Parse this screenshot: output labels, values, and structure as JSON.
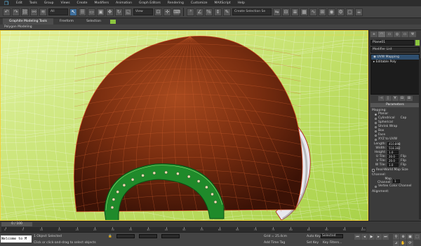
{
  "menu": [
    "Edit",
    "Tools",
    "Group",
    "Views",
    "Create",
    "Modifiers",
    "Animation",
    "Graph Editors",
    "Rendering",
    "Customize",
    "MAXScript",
    "Help"
  ],
  "toolbar": {
    "selection_filter": "All",
    "view_dropdown": "View",
    "named_selection": "Create Selection Se"
  },
  "ribbon": {
    "tabs": [
      "Graphite Modeling Tools",
      "Freeform",
      "Selection"
    ],
    "sub_label": "Polygon Modeling"
  },
  "viewport": {
    "colors": {
      "background": "#c8e66e",
      "sphere": "#7a2e10",
      "ring": "#1f8a2a",
      "border": "#f2d23b"
    }
  },
  "command_panel": {
    "tabs": [
      "+",
      "◠",
      "▭",
      "◎",
      "▭",
      "⚒"
    ],
    "object_name": "Plane01",
    "modifier_list": "Modifier List",
    "stack": [
      "UVW Mapping",
      "Editable Poly"
    ],
    "stack_buttons": [
      "⊣",
      "|",
      "∀",
      "⊟",
      "⊞"
    ],
    "rollout_title": "Parameters",
    "mapping_label": "Mapping:",
    "mapping_options": [
      {
        "label": "Planar",
        "selected": true
      },
      {
        "label": "Cylindrical",
        "selected": false,
        "extra": "Cap"
      },
      {
        "label": "Spherical",
        "selected": false
      },
      {
        "label": "Shrink Wrap",
        "selected": false
      },
      {
        "label": "Box",
        "selected": false
      },
      {
        "label": "Face",
        "selected": false
      },
      {
        "label": "XYZ to UVW",
        "selected": false
      }
    ],
    "length": {
      "label": "Length:",
      "value": "410.898"
    },
    "width": {
      "label": "Width:",
      "value": "518.382"
    },
    "height": {
      "label": "Height:",
      "value": "1.0"
    },
    "u_tile": {
      "label": "U Tile:",
      "value": "20.0",
      "flip": "Flip"
    },
    "v_tile": {
      "label": "V Tile:",
      "value": "20.0",
      "flip": "Flip"
    },
    "w_tile": {
      "label": "W Tile:",
      "value": "1.0",
      "flip": "Flip"
    },
    "real_world": "Real-World Map Size",
    "channel_label": "Channel:",
    "map_channel": "Map Channel:",
    "map_channel_value": "1",
    "vertex_color": "Vertex Color Channel",
    "alignment": "Alignment:"
  },
  "timeline": {
    "slider": "0 / 100",
    "ticks": [
      "0",
      "5",
      "10",
      "15",
      "20",
      "25",
      "30",
      "35",
      "40",
      "45",
      "50",
      "55",
      "60",
      "65",
      "70",
      "75",
      "80",
      "85",
      "90",
      "95",
      "100"
    ]
  },
  "status": {
    "welcome": "Welcome to M",
    "selected": "1 Object Selected",
    "prompt": "Click or click-and-drag to select objects",
    "grid": "Grid = 25.4cm",
    "add_time_tag": "Add Time Tag",
    "auto_key": "Auto Key",
    "set_key": "Set Key",
    "selected_drop": "Selected",
    "key_filters": "Key Filters..."
  }
}
